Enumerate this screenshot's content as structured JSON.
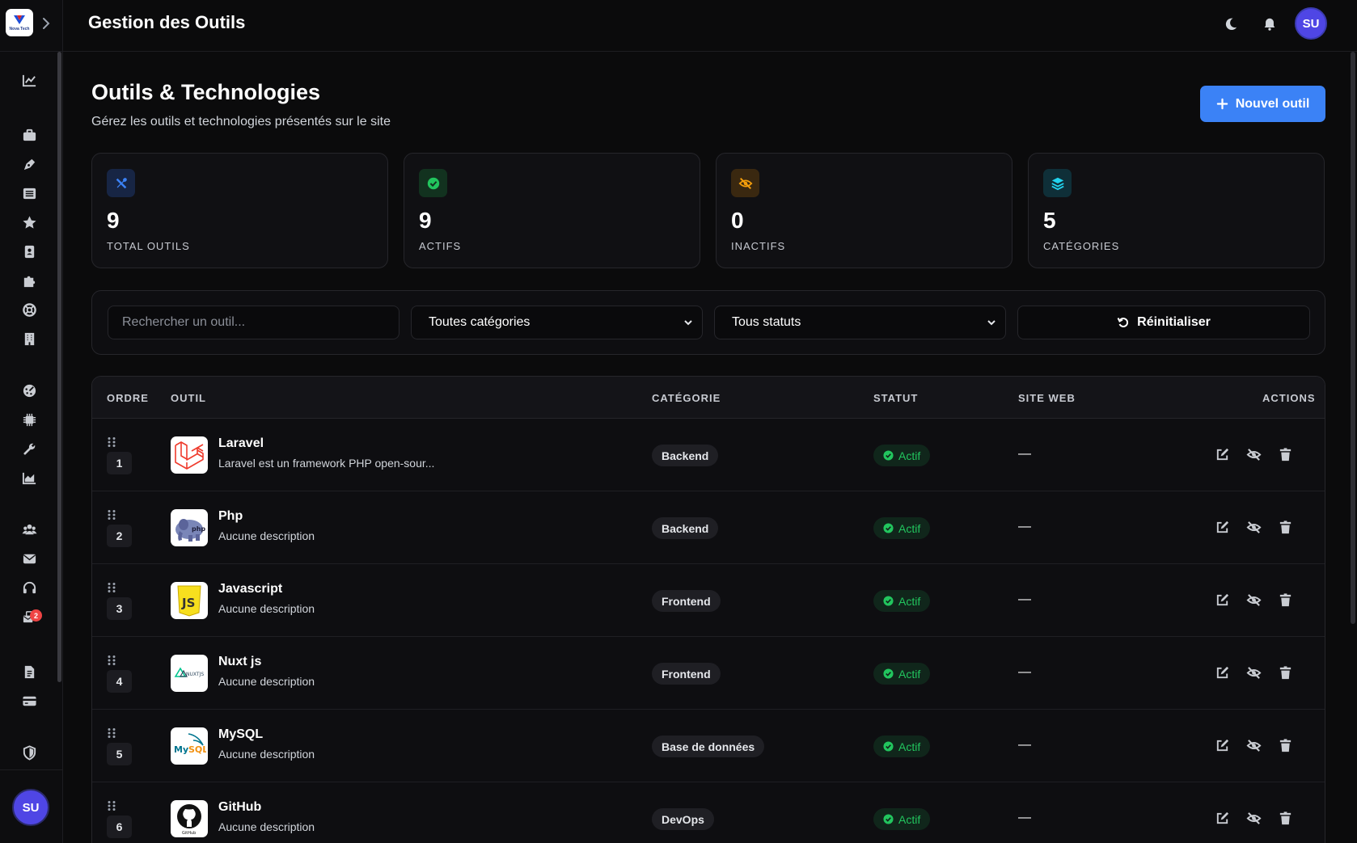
{
  "header": {
    "title": "Gestion des Outils",
    "avatar_initials": "SU"
  },
  "brand": {
    "logo_text": "Nova Tech"
  },
  "sidebar": {
    "icons": [
      "chart-line-icon",
      "briefcase-icon",
      "pen-nib-icon",
      "list-icon",
      "star-icon",
      "address-book-icon",
      "puzzle-icon",
      "life-ring-icon",
      "building-icon",
      "palette-icon",
      "microchip-icon",
      "wrench-icon",
      "chart-area-icon",
      "users-icon",
      "envelope-icon",
      "headset-icon",
      "mail-bulk-icon",
      "file-alt-icon",
      "credit-card-icon",
      "shield-icon"
    ],
    "notification_badge": "2",
    "avatar_initials": "SU"
  },
  "page": {
    "title": "Outils & Technologies",
    "subtitle": "Gérez les outils et technologies présentés sur le site",
    "new_button": "Nouvel outil"
  },
  "stats": [
    {
      "value": "9",
      "label": "TOTAL OUTILS",
      "icon": "tools-icon",
      "color": "#3b82f6"
    },
    {
      "value": "9",
      "label": "ACTIFS",
      "icon": "check-circle-icon",
      "color": "#22c55e"
    },
    {
      "value": "0",
      "label": "INACTIFS",
      "icon": "eye-slash-icon",
      "color": "#f59e0b"
    },
    {
      "value": "5",
      "label": "CATÉGORIES",
      "icon": "layers-icon",
      "color": "#22d3ee"
    }
  ],
  "filters": {
    "search_placeholder": "Rechercher un outil...",
    "category_selected": "Toutes catégories",
    "status_selected": "Tous statuts",
    "reset_label": "Réinitialiser"
  },
  "table": {
    "headers": {
      "order": "ORDRE",
      "tool": "OUTIL",
      "category": "CATÉGORIE",
      "status": "STATUT",
      "website": "SITE WEB",
      "actions": "ACTIONS"
    },
    "rows": [
      {
        "order": "1",
        "name": "Laravel",
        "description": "Laravel est un framework PHP open-sour...",
        "category": "Backend",
        "status": "Actif",
        "website": "—",
        "logo": "laravel-logo"
      },
      {
        "order": "2",
        "name": "Php",
        "description": "Aucune description",
        "category": "Backend",
        "status": "Actif",
        "website": "—",
        "logo": "php-logo"
      },
      {
        "order": "3",
        "name": "Javascript",
        "description": "Aucune description",
        "category": "Frontend",
        "status": "Actif",
        "website": "—",
        "logo": "javascript-logo"
      },
      {
        "order": "4",
        "name": "Nuxt js",
        "description": "Aucune description",
        "category": "Frontend",
        "status": "Actif",
        "website": "—",
        "logo": "nuxt-logo"
      },
      {
        "order": "5",
        "name": "MySQL",
        "description": "Aucune description",
        "category": "Base de données",
        "status": "Actif",
        "website": "—",
        "logo": "mysql-logo"
      },
      {
        "order": "6",
        "name": "GitHub",
        "description": "Aucune description",
        "category": "DevOps",
        "status": "Actif",
        "website": "—",
        "logo": "github-logo"
      }
    ]
  },
  "colors": {
    "accent": "#3b82f6",
    "success": "#22c55e",
    "warning": "#f59e0b",
    "info": "#22d3ee",
    "danger": "#ef4444"
  }
}
